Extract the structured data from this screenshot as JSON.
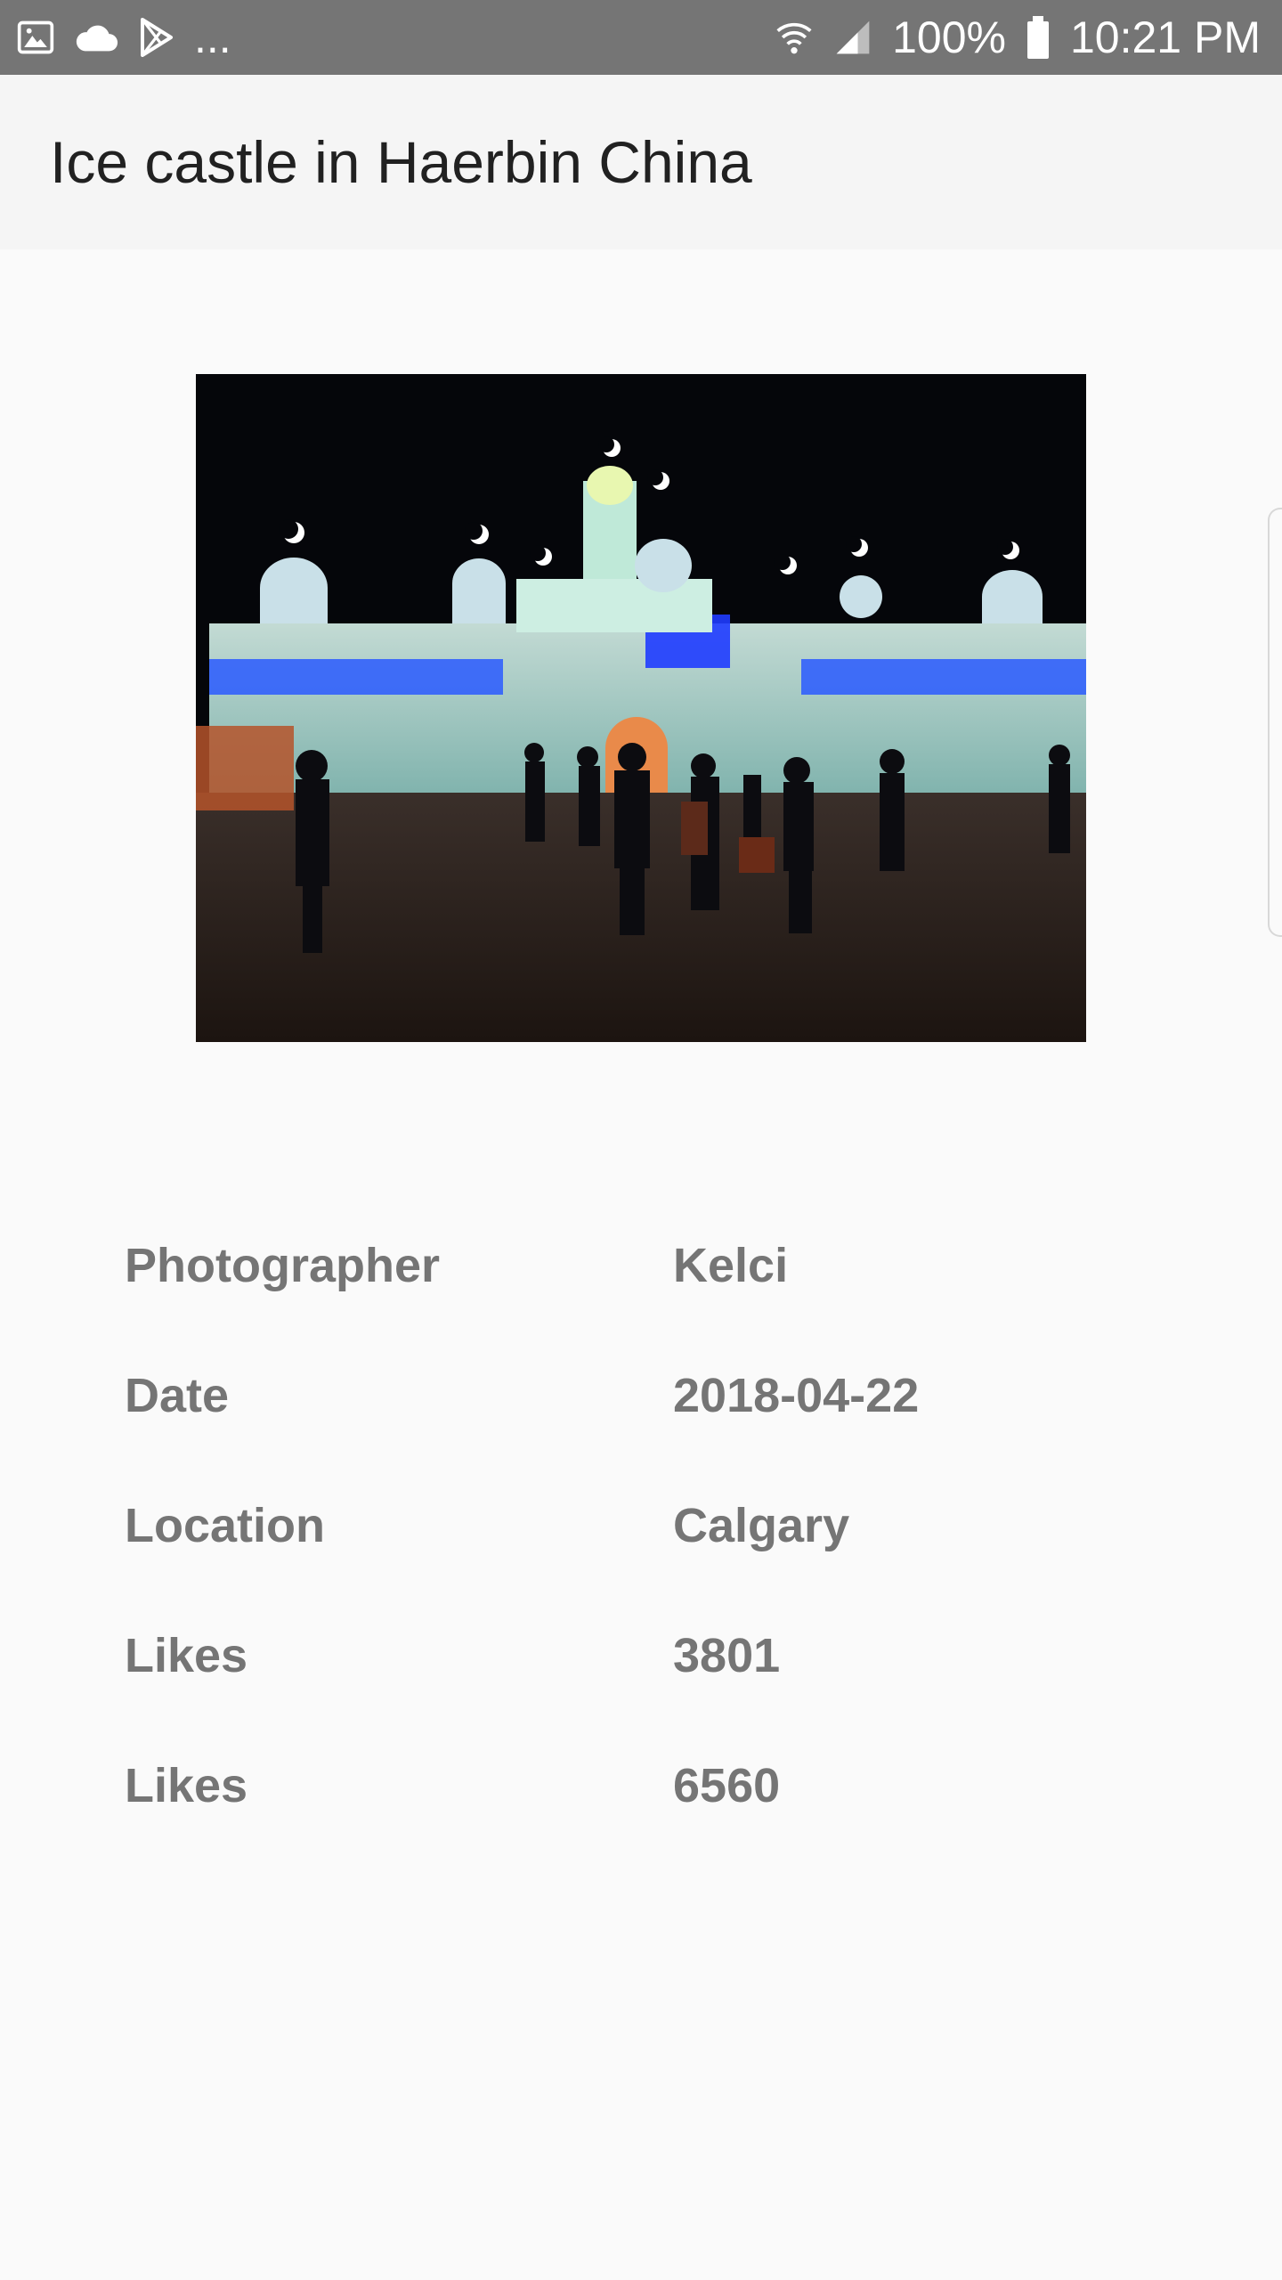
{
  "status_bar": {
    "left_icons": [
      "image-icon",
      "cloud-icon",
      "play-store-icon"
    ],
    "ellipsis": "...",
    "battery_percent": "100%",
    "time": "10:21 PM",
    "right_icons": [
      "wifi-icon",
      "signal-icon",
      "battery-icon"
    ]
  },
  "app_bar": {
    "title": "Ice castle in Haerbin China"
  },
  "details": [
    {
      "label": "Photographer",
      "value": "Kelci"
    },
    {
      "label": "Date",
      "value": "2018-04-22"
    },
    {
      "label": "Location",
      "value": "Calgary"
    },
    {
      "label": "Likes",
      "value": "3801"
    },
    {
      "label": "Likes",
      "value": "6560"
    }
  ],
  "colors": {
    "status_bar": "#757575",
    "app_bar": "#f5f5f5",
    "background": "#fafafa",
    "title_text": "#212121",
    "detail_text": "#757575"
  }
}
